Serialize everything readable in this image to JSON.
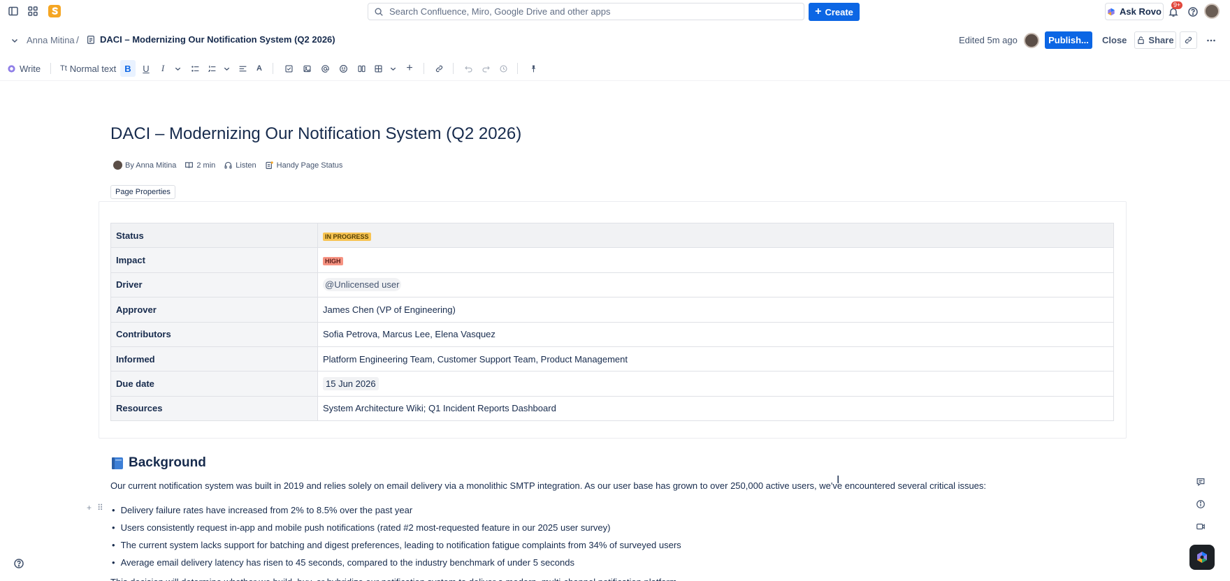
{
  "topnav": {
    "search_placeholder": "Search Confluence, Miro, Google Drive and other apps",
    "create_label": "Create",
    "ask_rovo_label": "Ask Rovo",
    "notifications_badge": "9+",
    "icons": [
      "sidebar-toggle-icon",
      "app-switcher-icon",
      "confluence-logo",
      "search-icon",
      "plus-icon",
      "rovo-icon",
      "bell-icon",
      "help-icon",
      "profile-avatar"
    ]
  },
  "pagebar": {
    "breadcrumb_user": "Anna Mitina",
    "breadcrumb_separator": "/",
    "breadcrumb_page": "DACI – Modernizing Our Notification System (Q2 2026)",
    "edited_text": "Edited 5m ago",
    "publish_label": "Publish...",
    "close_label": "Close",
    "share_label": "Share",
    "accent": "#0c66e4"
  },
  "toolbar": {
    "write_label": "Write",
    "text_style_prefix": "Tt",
    "text_style_label": "Normal text",
    "bold_label": "B",
    "underline_label": "U",
    "italic_label": "I",
    "text_color_label": "A"
  },
  "page": {
    "title": "DACI – Modernizing Our Notification System (Q2 2026)",
    "byline": {
      "author": "By Anna Mitina",
      "read_time": "2 min",
      "listen": "Listen",
      "status": "Handy Page Status"
    },
    "page_properties_label": "Page Properties",
    "properties": [
      {
        "key": "Status",
        "value": "IN PROGRESS",
        "kind": "lozenge-yellow"
      },
      {
        "key": "Impact",
        "value": "HIGH",
        "kind": "lozenge-red"
      },
      {
        "key": "Driver",
        "value": "@Unlicensed user",
        "kind": "mention"
      },
      {
        "key": "Approver",
        "value": "James Chen (VP of Engineering)",
        "kind": "text"
      },
      {
        "key": "Contributors",
        "value": "Sofia Petrova, Marcus Lee, Elena Vasquez",
        "kind": "text"
      },
      {
        "key": "Informed",
        "value": "Platform Engineering Team, Customer Support Team, Product Management",
        "kind": "text"
      },
      {
        "key": "Due date",
        "value": "15 Jun 2026",
        "kind": "date"
      },
      {
        "key": "Resources",
        "value": "System Architecture Wiki; Q1 Incident Reports Dashboard",
        "kind": "text"
      }
    ],
    "background": {
      "heading": "Background",
      "intro": "Our current notification system was built in 2019 and relies solely on email delivery via a monolithic SMTP integration. As our user base has grown to over 250,000 active users, we've encountered several critical issues:",
      "bullets": [
        "Delivery failure rates have increased from 2% to 8.5% over the past year",
        "Users consistently request in-app and mobile push notifications (rated #2 most-requested feature in our 2025 user survey)",
        "The current system lacks support for batching and digest preferences, leading to notification fatigue complaints from 34% of surveyed users",
        "Average email delivery latency has risen to 45 seconds, compared to the industry benchmark of under 5 seconds"
      ],
      "cut_line": "This decision will determine whether we build, buy, or hybridize our notification system to deliver a modern, multi-channel notification platform."
    }
  }
}
